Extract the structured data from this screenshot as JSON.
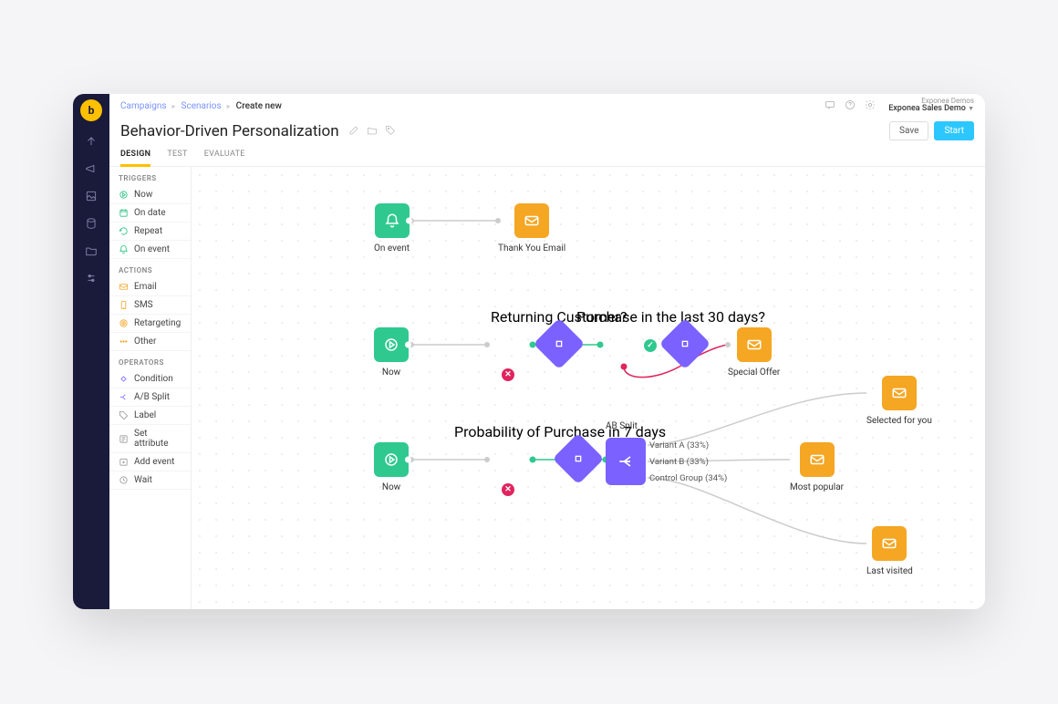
{
  "breadcrumbs": {
    "a": "Campaigns",
    "b": "Scenarios",
    "c": "Create new"
  },
  "account": {
    "line1": "Exponea Demos",
    "line2": "Exponea Sales Demo"
  },
  "page_title": "Behavior-Driven Personalization",
  "buttons": {
    "save": "Save",
    "start": "Start"
  },
  "tabs": {
    "design": "DESIGN",
    "test": "TEST",
    "evaluate": "EVALUATE"
  },
  "sidebar": {
    "triggers_h": "TRIGGERS",
    "actions_h": "ACTIONS",
    "operators_h": "OPERATORS",
    "triggers": {
      "now": "Now",
      "on_date": "On date",
      "repeat": "Repeat",
      "on_event": "On event"
    },
    "actions": {
      "email": "Email",
      "sms": "SMS",
      "retargeting": "Retargeting",
      "other": "Other"
    },
    "operators": {
      "condition": "Condition",
      "ab_split": "A/B Split",
      "label": "Label",
      "set_attribute": "Set attribute",
      "add_event": "Add event",
      "wait": "Wait"
    }
  },
  "nodes": {
    "on_event": "On event",
    "thank_you_email": "Thank You Email",
    "returning_customer": "Returning Customer?",
    "purchase_30": "Purchase in the last 30 days?",
    "now1": "Now",
    "special_offer": "Special Offer",
    "probability": "Probability of Purchase in 7 days",
    "ab_split": "AB Split",
    "variant_a": "Variant A (33%)",
    "variant_b": "Variant B (33%)",
    "control": "Control Group (34%)",
    "now2": "Now",
    "selected": "Selected for you",
    "most_popular": "Most popular",
    "last_visited": "Last visited"
  }
}
